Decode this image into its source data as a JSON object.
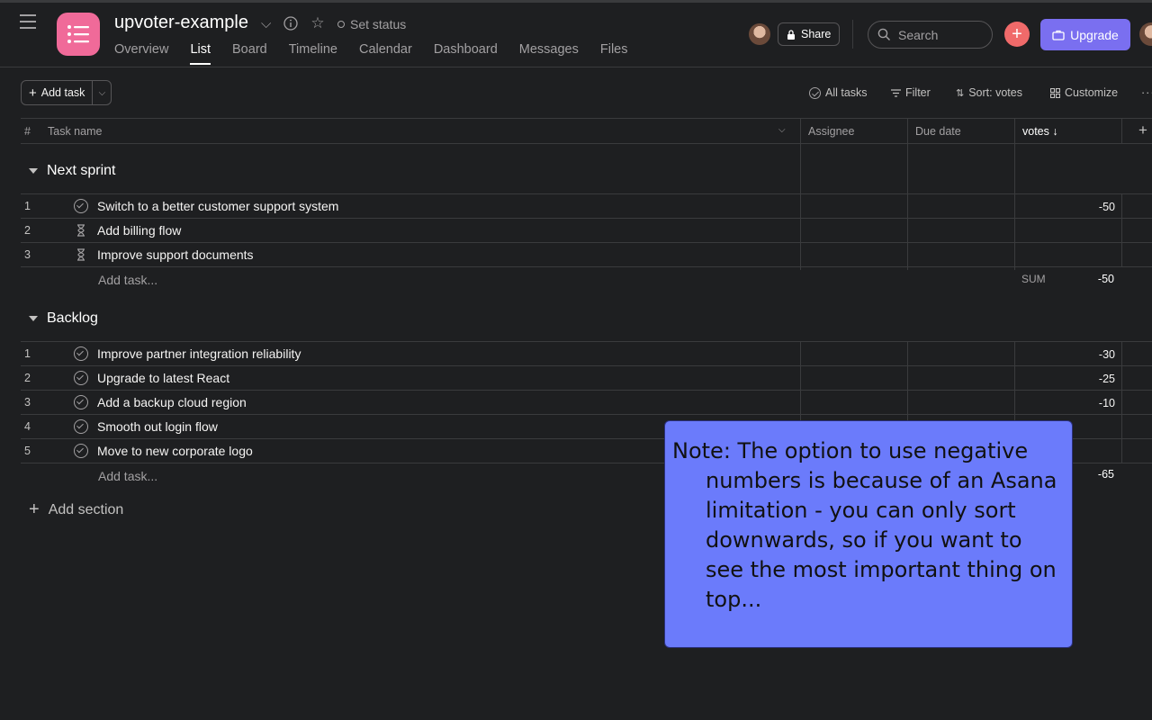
{
  "header": {
    "project_title": "upvoter-example",
    "set_status": "Set status",
    "tabs": [
      {
        "label": "Overview",
        "active": false
      },
      {
        "label": "List",
        "active": true
      },
      {
        "label": "Board",
        "active": false
      },
      {
        "label": "Timeline",
        "active": false
      },
      {
        "label": "Calendar",
        "active": false
      },
      {
        "label": "Dashboard",
        "active": false
      },
      {
        "label": "Messages",
        "active": false
      },
      {
        "label": "Files",
        "active": false
      }
    ],
    "share_label": "Share",
    "search_placeholder": "Search",
    "upgrade_label": "Upgrade",
    "accent_color": "#f06a99",
    "upgrade_color": "#7a6ff0"
  },
  "toolbar": {
    "add_task_label": "Add task",
    "all_tasks_label": "All tasks",
    "filter_label": "Filter",
    "sort_label": "Sort: votes",
    "customize_label": "Customize"
  },
  "columns": {
    "num": "#",
    "task_name": "Task name",
    "assignee": "Assignee",
    "due_date": "Due date",
    "votes": "votes ↓"
  },
  "sections": [
    {
      "title": "Next sprint",
      "tasks": [
        {
          "num": "1",
          "icon": "check-circle-icon",
          "name": "Switch to a better customer support system",
          "votes": "-50"
        },
        {
          "num": "2",
          "icon": "hourglass-icon",
          "name": "Add billing flow",
          "votes": ""
        },
        {
          "num": "3",
          "icon": "hourglass-icon",
          "name": "Improve support documents",
          "votes": ""
        }
      ],
      "add_task": "Add task...",
      "sum_label": "SUM",
      "sum_value": "-50"
    },
    {
      "title": "Backlog",
      "tasks": [
        {
          "num": "1",
          "icon": "check-circle-icon",
          "name": "Improve partner integration reliability",
          "votes": "-30"
        },
        {
          "num": "2",
          "icon": "check-circle-icon",
          "name": "Upgrade to latest React",
          "votes": "-25"
        },
        {
          "num": "3",
          "icon": "check-circle-icon",
          "name": "Add a backup cloud region",
          "votes": "-10"
        },
        {
          "num": "4",
          "icon": "check-circle-icon",
          "name": "Smooth out login flow",
          "votes": ""
        },
        {
          "num": "5",
          "icon": "check-circle-icon",
          "name": "Move to new corporate logo",
          "votes": ""
        }
      ],
      "add_task": "Add task...",
      "sum_value": "-65"
    }
  ],
  "add_section": "Add section",
  "note": {
    "text": "Note: The option to use negative numbers is because of an Asana limitation - you can only sort downwards, so if you want to see the most important thing on top...",
    "background": "#6b7bfb"
  }
}
